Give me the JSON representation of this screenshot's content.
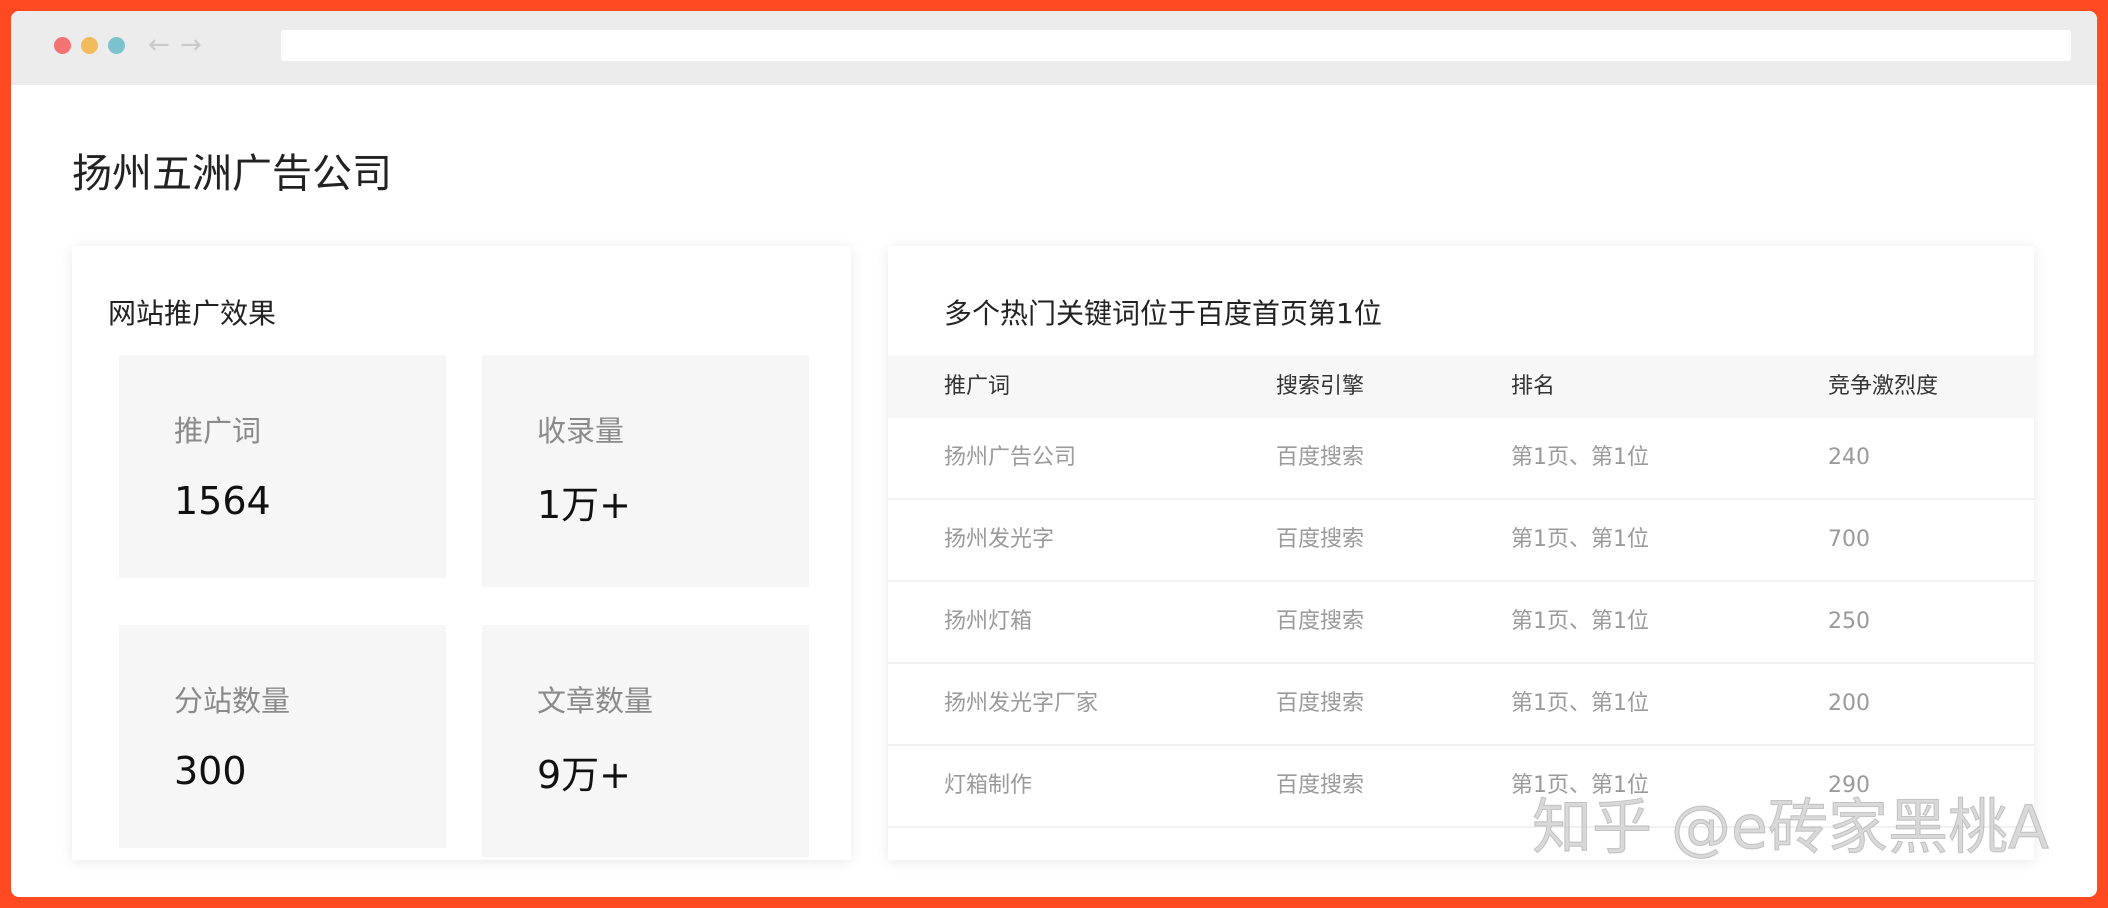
{
  "browser": {
    "dots": [
      "#f37272",
      "#f2bb5c",
      "#7cc2cc"
    ],
    "back_glyph": "←",
    "forward_glyph": "→",
    "url": ""
  },
  "page": {
    "title": "扬州五洲广告公司"
  },
  "promo": {
    "title": "网站推广效果",
    "stats": [
      {
        "label": "推广词",
        "value": "1564"
      },
      {
        "label": "收录量",
        "value": "1万+"
      },
      {
        "label": "分站数量",
        "value": "300"
      },
      {
        "label": "文章数量",
        "value": "9万+"
      }
    ]
  },
  "keywords": {
    "title": "多个热门关键词位于百度首页第1位",
    "columns": [
      "推广词",
      "搜索引擎",
      "排名",
      "竞争激烈度"
    ],
    "rows": [
      [
        "扬州广告公司",
        "百度搜索",
        "第1页、第1位",
        "240"
      ],
      [
        "扬州发光字",
        "百度搜索",
        "第1页、第1位",
        "700"
      ],
      [
        "扬州灯箱",
        "百度搜索",
        "第1页、第1位",
        "250"
      ],
      [
        "扬州发光字厂家",
        "百度搜索",
        "第1页、第1位",
        "200"
      ],
      [
        "灯箱制作",
        "百度搜索",
        "第1页、第1位",
        "290"
      ]
    ]
  },
  "watermark": "知乎 @e砖家黑桃A",
  "colors": {
    "frame": "#ff4a22",
    "stat_bg": "#f6f6f6",
    "table_head_bg": "#f7f7f7"
  }
}
